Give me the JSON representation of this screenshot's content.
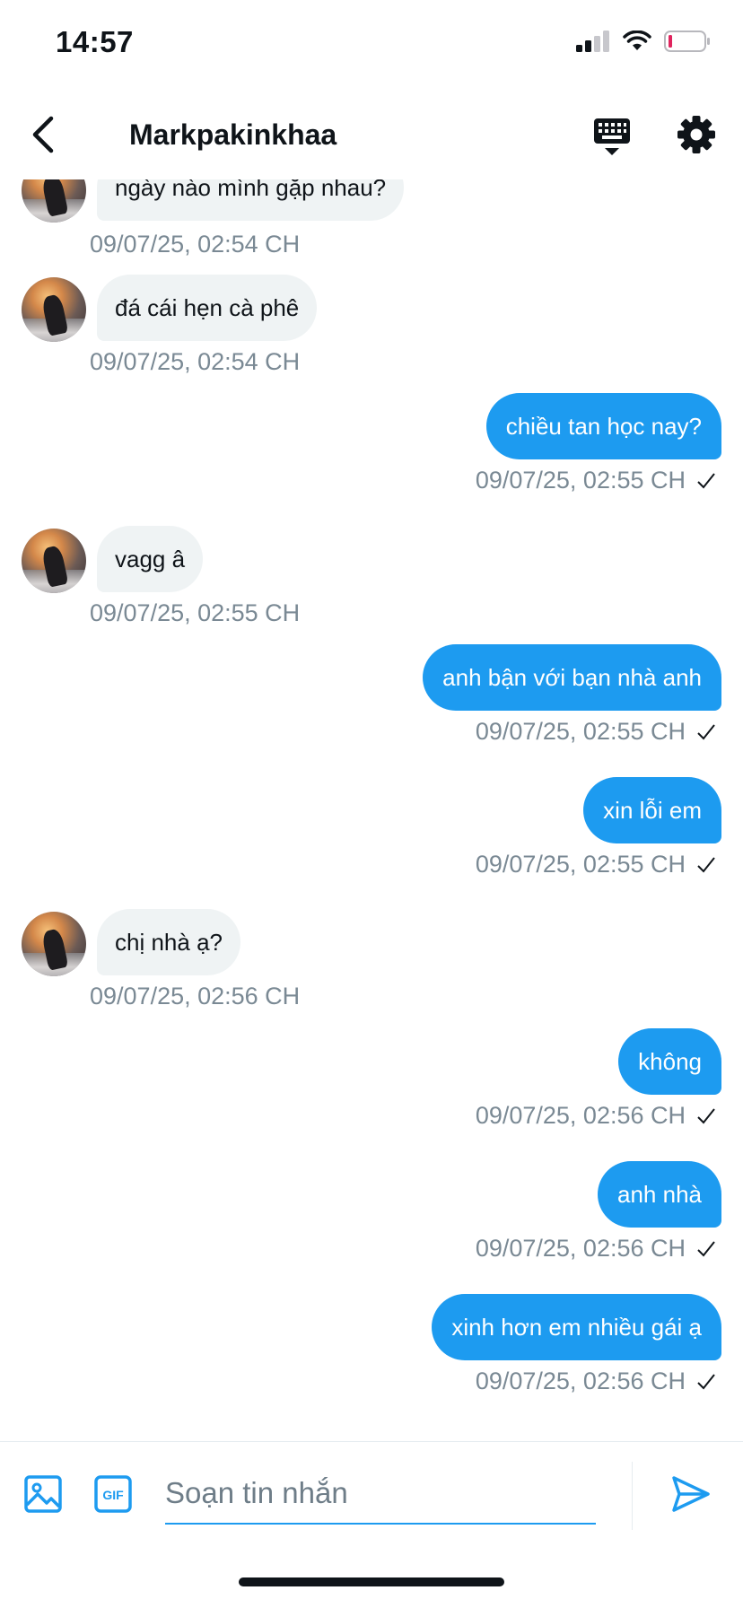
{
  "status_bar": {
    "time": "14:57"
  },
  "header": {
    "title": "Markpakinkhaa"
  },
  "messages": [
    {
      "direction": "in",
      "text": "ngày nào mình gặp nhau?",
      "time": "09/07/25, 02:54 CH"
    },
    {
      "direction": "in",
      "text": "đá cái hẹn cà phê",
      "time": "09/07/25, 02:54 CH"
    },
    {
      "direction": "out",
      "text": "chiều tan học nay?",
      "time": "09/07/25, 02:55 CH"
    },
    {
      "direction": "in",
      "text": "vagg â",
      "time": "09/07/25, 02:55 CH"
    },
    {
      "direction": "out",
      "text": "anh bận với bạn nhà anh",
      "time": "09/07/25, 02:55 CH"
    },
    {
      "direction": "out",
      "text": "xin lỗi em",
      "time": "09/07/25, 02:55 CH"
    },
    {
      "direction": "in",
      "text": "chị nhà ạ?",
      "time": "09/07/25, 02:56 CH"
    },
    {
      "direction": "out",
      "text": "không",
      "time": "09/07/25, 02:56 CH"
    },
    {
      "direction": "out",
      "text": "anh nhà",
      "time": "09/07/25, 02:56 CH"
    },
    {
      "direction": "out",
      "text": "xinh hơn em nhiều gái ạ",
      "time": "09/07/25, 02:56 CH"
    }
  ],
  "composer": {
    "placeholder": "Soạn tin nhắn",
    "gif_label": "GIF"
  },
  "colors": {
    "accent": "#1d9bf0",
    "incoming_bubble": "#eff3f4",
    "timestamp": "#7a8994",
    "battery_low": "#e0245e"
  }
}
